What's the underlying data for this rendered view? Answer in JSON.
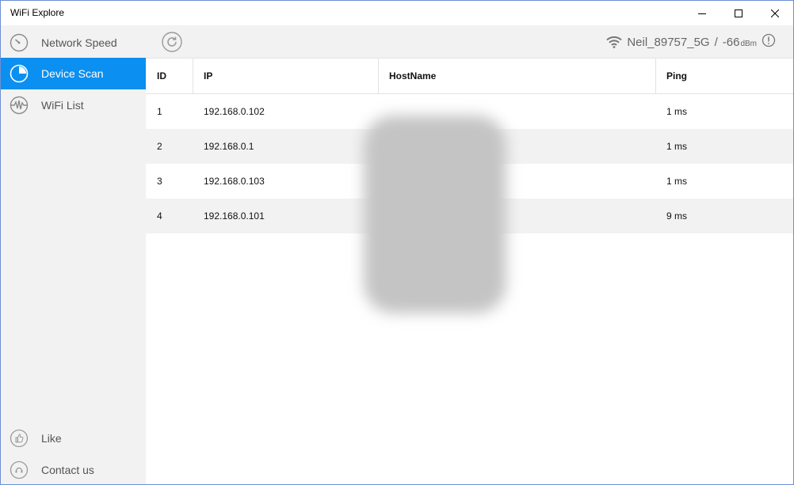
{
  "window": {
    "title": "WiFi Explore",
    "accent": "#0b8ff0"
  },
  "sidebar": {
    "items": [
      {
        "label": "Network Speed",
        "icon": "speedometer-icon",
        "active": false
      },
      {
        "label": "Device Scan",
        "icon": "pie-chart-icon",
        "active": true
      },
      {
        "label": "WiFi List",
        "icon": "waveform-icon",
        "active": false
      }
    ],
    "bottom": [
      {
        "label": "Like",
        "icon": "thumbs-up-icon"
      },
      {
        "label": "Contact us",
        "icon": "contact-icon"
      }
    ]
  },
  "toolbar": {
    "refresh_icon": "refresh-icon",
    "ssid": "Neil_89757_5G",
    "separator": "/",
    "signal": "-66",
    "signal_unit": "dBm",
    "info_icon": "info-icon"
  },
  "table": {
    "columns": [
      "ID",
      "IP",
      "HostName",
      "Ping"
    ],
    "rows": [
      {
        "id": "1",
        "ip": "192.168.0.102",
        "host": "",
        "ping": "1 ms"
      },
      {
        "id": "2",
        "ip": "192.168.0.1",
        "host": "",
        "ping": "1 ms"
      },
      {
        "id": "3",
        "ip": "192.168.0.103",
        "host": "",
        "ping": "1 ms"
      },
      {
        "id": "4",
        "ip": "192.168.0.101",
        "host": "",
        "ping": "9 ms"
      }
    ]
  }
}
